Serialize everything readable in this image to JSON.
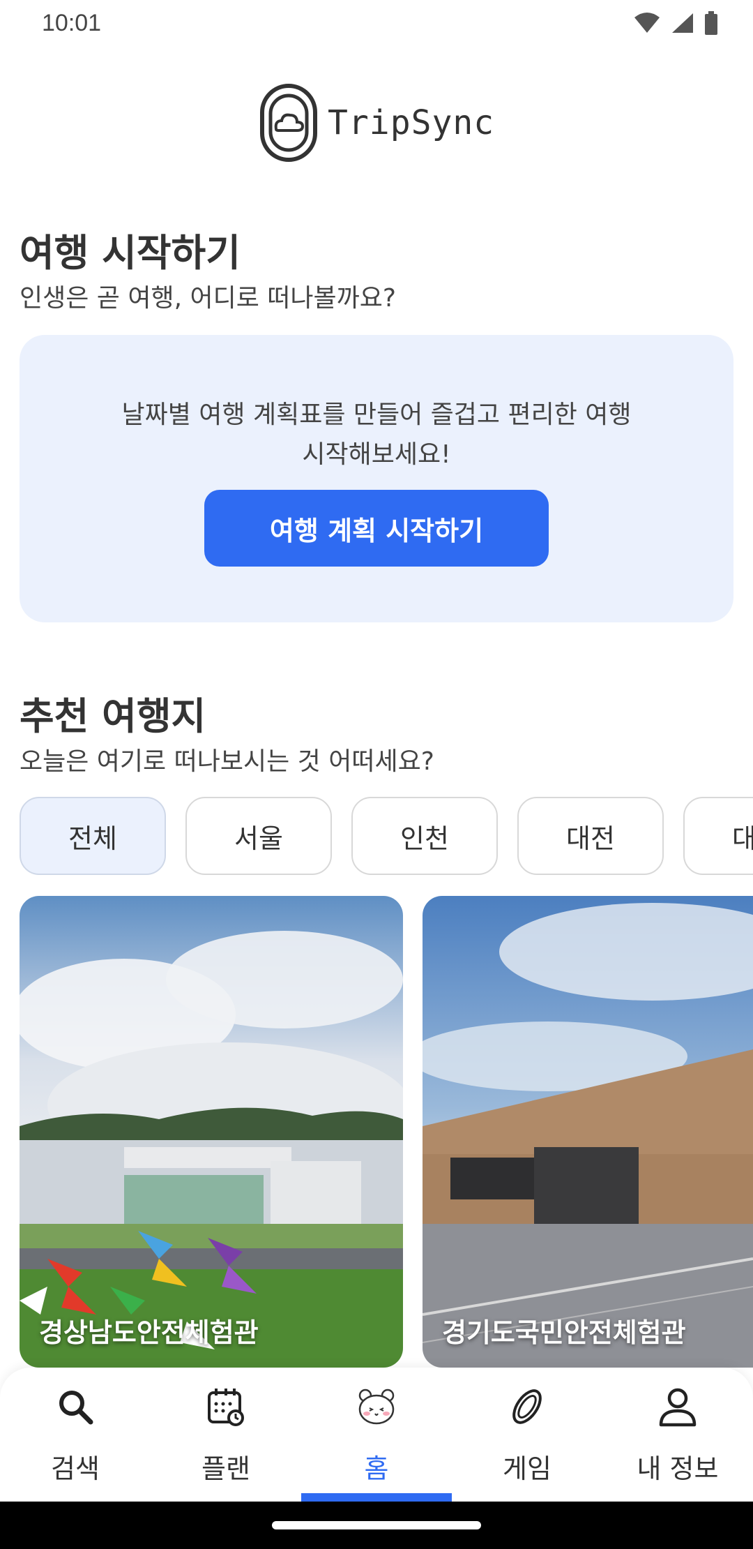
{
  "status_bar": {
    "time": "10:01"
  },
  "app": {
    "name": "TripSync"
  },
  "start_section": {
    "title": "여행 시작하기",
    "subtitle": "인생은 곧 여행, 어디로 떠나볼까요?",
    "card": {
      "description_line1": "날짜별 여행 계획표를 만들어 즐겁고 편리한 여행",
      "description_line2": "시작해보세요!",
      "button_label": "여행 계획 시작하기"
    }
  },
  "recommend_section": {
    "title": "추천 여행지",
    "subtitle": "오늘은 여기로 떠나보시는 것 어떠세요?",
    "chips": [
      {
        "label": "전체",
        "selected": true
      },
      {
        "label": "서울",
        "selected": false
      },
      {
        "label": "인천",
        "selected": false
      },
      {
        "label": "대전",
        "selected": false
      },
      {
        "label": "대구",
        "selected": false
      }
    ],
    "cards": [
      {
        "name": "경상남도안전체험관"
      },
      {
        "name": "경기도국민안전체험관"
      }
    ]
  },
  "bottom_nav": {
    "items": [
      {
        "label": "검색",
        "icon": "search-icon"
      },
      {
        "label": "플랜",
        "icon": "calendar-icon"
      },
      {
        "label": "홈",
        "icon": "home-mascot-icon",
        "active": true
      },
      {
        "label": "게임",
        "icon": "coin-icon"
      },
      {
        "label": "내 정보",
        "icon": "profile-icon"
      }
    ]
  },
  "colors": {
    "accent": "#2f6bf2",
    "card_bg": "#ebf1fd"
  }
}
